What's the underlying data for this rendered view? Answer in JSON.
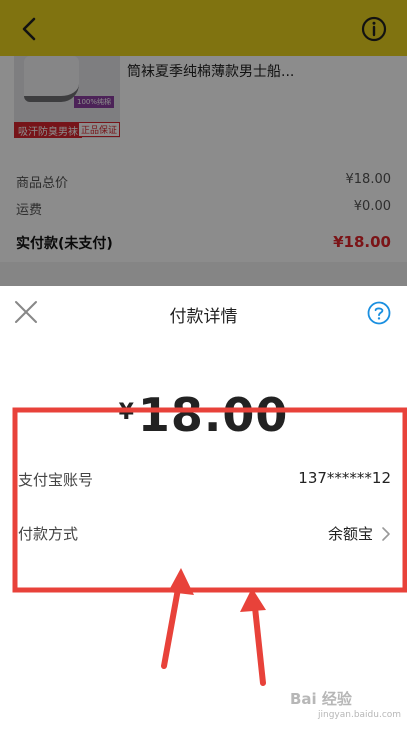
{
  "header": {
    "background_color": "#e9d21e"
  },
  "product": {
    "title": "筒袜夏季纯棉薄款男士船...",
    "image_tags": [
      "100%纯棉",
      "吸汗防臭男袜",
      "正品保证"
    ]
  },
  "price_summary": {
    "rows": [
      {
        "label": "商品总价",
        "value": "¥18.00"
      },
      {
        "label": "运费",
        "value": "¥0.00"
      },
      {
        "label": "实付款(未支付)",
        "value": "¥18.00"
      }
    ],
    "accent_color": "#e0262b"
  },
  "payment_sheet": {
    "title": "付款详情",
    "amount_currency": "¥",
    "amount_value": "18.00",
    "rows": [
      {
        "label": "支付宝账号",
        "value": "137******12"
      },
      {
        "label": "付款方式",
        "value": "余额宝"
      }
    ],
    "help_color": "#1a8fe0"
  },
  "annotation": {
    "color": "#e8423a"
  },
  "watermark": {
    "text": "Bai 经验",
    "sub": "jingyan.baidu.com"
  }
}
